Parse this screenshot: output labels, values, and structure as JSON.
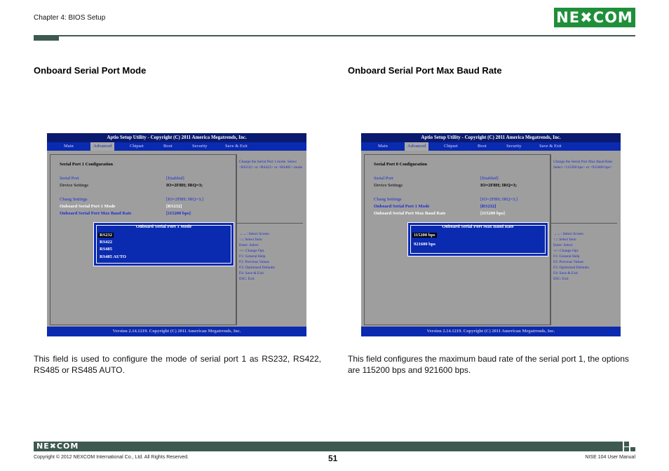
{
  "header": {
    "chapter": "Chapter 4: BIOS Setup",
    "logo": "NE✖COM"
  },
  "left": {
    "title": "Onboard Serial Port Mode",
    "description": "This field is used to configure the mode of serial port 1 as RS232, RS422, RS485 or RS485 AUTO.",
    "bios": {
      "topbar": "Aptio Setup Utility - Copyright (C) 2011 America Megatrends, Inc.",
      "menus": [
        "Main",
        "Advanced",
        "Chipset",
        "Boot",
        "Security",
        "Save & Exit"
      ],
      "section": "Serial Port 1 Configuration",
      "rows": [
        {
          "label": "Serial Port",
          "value": "[Enabled]"
        },
        {
          "label": "Device Settings",
          "value": "IO=2F8H;  IRQ=3;"
        },
        {
          "label": "Chang Settings",
          "value": "[IO=2F8H;  IRQ=3;]"
        },
        {
          "label": "Onboard Serial Port 1 Mode",
          "value": "[RS232]"
        },
        {
          "label": "Onboard Serial Port Max Baud Rate",
          "value": "[115200     bps]"
        }
      ],
      "help": "Change the Serial Port 1 mode. Select <RS232> or <RS422> or <RS485> mode",
      "keys": [
        "→←: Select Screen",
        "↑↓: Select Item",
        "Enter: Select",
        "+/-: Change Opt.",
        "F1: General Help",
        "F2: Previous Values",
        "F3: Optimized Defaults",
        "F4: Save & Exit",
        "ESC: Exit"
      ],
      "popup_title": "Onboard Serial Port 1 Mode",
      "popup_options": [
        "RS232",
        "RS422",
        "RS485",
        "RS485    AUTO"
      ],
      "footer": "Version 2.14.1219. Copyright (C) 2011 American Megatrends, Inc."
    }
  },
  "right": {
    "title": "Onboard Serial Port Max Baud Rate",
    "description": "This field configures the maximum baud rate of the serial port 1, the options are 115200 bps and 921600 bps.",
    "bios": {
      "topbar": "Aptio Setup Utility - Copyright (C) 2011 America Megatrends, Inc.",
      "menus": [
        "Main",
        "Advanced",
        "Chipset",
        "Boot",
        "Security",
        "Save & Exit"
      ],
      "section": "Serial Port 0 Configuration",
      "rows": [
        {
          "label": "Serial Port",
          "value": "[Enabled]"
        },
        {
          "label": "Device Settings",
          "value": "IO=2F8H;  IRQ=3;"
        },
        {
          "label": "Chang Settings",
          "value": "[IO=2F8H;  IRQ=3;]"
        },
        {
          "label": "Onboard Serial Port 1 Mode",
          "value": "[RS232]"
        },
        {
          "label": "Onboard Serial Port Max Baud Rate",
          "value": "[115200     bps]"
        }
      ],
      "help": "Change the Serial Port Max Baud Rate. Select <115200 bps> or <921600 bps>",
      "keys": [
        "→←: Select Screen",
        "↑↓: Select Item",
        "Enter: Select",
        "+/-: Change Opt.",
        "F1: General Help",
        "F2: Previous Values",
        "F3: Optimized Defaults",
        "F4: Save & Exit",
        "ESC: Exit"
      ],
      "popup_title": "Onboard Serial Port Max Baud Rate",
      "popup_options": [
        "115200   bps",
        "921600   bps"
      ],
      "footer": "Version 2.14.1219. Copyright (C) 2011 American Megatrends, Inc."
    }
  },
  "footer": {
    "logo": "NE✖COM",
    "copyright": "Copyright © 2012 NEXCOM International Co., Ltd. All Rights Reserved.",
    "page": "51",
    "manual": "NISE 104 User Manual"
  }
}
